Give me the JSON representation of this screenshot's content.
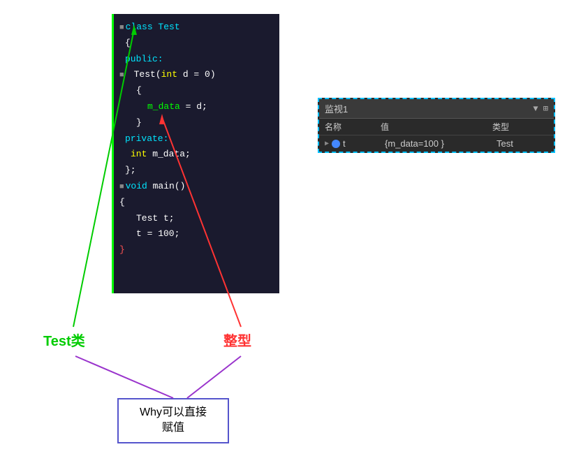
{
  "code_panel": {
    "lines": [
      {
        "indent": 0,
        "minus": true,
        "parts": [
          {
            "text": "class Test",
            "cls": "kw-cyan"
          }
        ]
      },
      {
        "indent": 0,
        "minus": false,
        "parts": [
          {
            "text": "{",
            "cls": "kw-white"
          }
        ]
      },
      {
        "indent": 1,
        "minus": false,
        "parts": [
          {
            "text": "public:",
            "cls": "kw-cyan"
          }
        ]
      },
      {
        "indent": 1,
        "minus": true,
        "parts": [
          {
            "text": "Test(",
            "cls": "kw-white"
          },
          {
            "text": "int",
            "cls": "kw-yellow"
          },
          {
            "text": " d = 0)",
            "cls": "kw-white"
          }
        ]
      },
      {
        "indent": 2,
        "minus": false,
        "parts": [
          {
            "text": "{",
            "cls": "kw-white"
          }
        ]
      },
      {
        "indent": 3,
        "minus": false,
        "parts": [
          {
            "text": "m_data",
            "cls": "kw-green"
          },
          {
            "text": " = d;",
            "cls": "kw-white"
          }
        ]
      },
      {
        "indent": 2,
        "minus": false,
        "parts": [
          {
            "text": "}",
            "cls": "kw-white"
          }
        ]
      },
      {
        "indent": 1,
        "minus": false,
        "parts": [
          {
            "text": "private:",
            "cls": "kw-cyan"
          }
        ]
      },
      {
        "indent": 2,
        "minus": false,
        "parts": [
          {
            "text": "int",
            "cls": "kw-yellow"
          },
          {
            "text": " m_data;",
            "cls": "kw-white"
          }
        ]
      },
      {
        "indent": 1,
        "minus": false,
        "parts": [
          {
            "text": "};",
            "cls": "kw-white"
          }
        ]
      },
      {
        "indent": 0,
        "minus": true,
        "parts": [
          {
            "text": "void",
            "cls": "kw-cyan"
          },
          {
            "text": " main()",
            "cls": "kw-white"
          }
        ]
      },
      {
        "indent": 0,
        "minus": false,
        "parts": [
          {
            "text": "{",
            "cls": "kw-white"
          }
        ]
      },
      {
        "indent": 2,
        "minus": false,
        "parts": [
          {
            "text": "Test t;",
            "cls": "kw-white"
          }
        ]
      },
      {
        "indent": 2,
        "minus": false,
        "parts": [
          {
            "text": "t = 100;",
            "cls": "kw-white"
          }
        ]
      },
      {
        "indent": 0,
        "minus": false,
        "parts": [
          {
            "text": "}",
            "cls": "kw-red"
          }
        ]
      }
    ]
  },
  "watch_panel": {
    "title": "监视1",
    "pin_icon": "▼",
    "columns": [
      "名称",
      "值",
      "类型"
    ],
    "row": {
      "expand": "▶",
      "var_name": "t",
      "value": "{m_data=100 }",
      "type": "Test"
    }
  },
  "labels": {
    "test_class": "Test类",
    "int_type": "整型",
    "question": "Why可以直接赋值"
  }
}
